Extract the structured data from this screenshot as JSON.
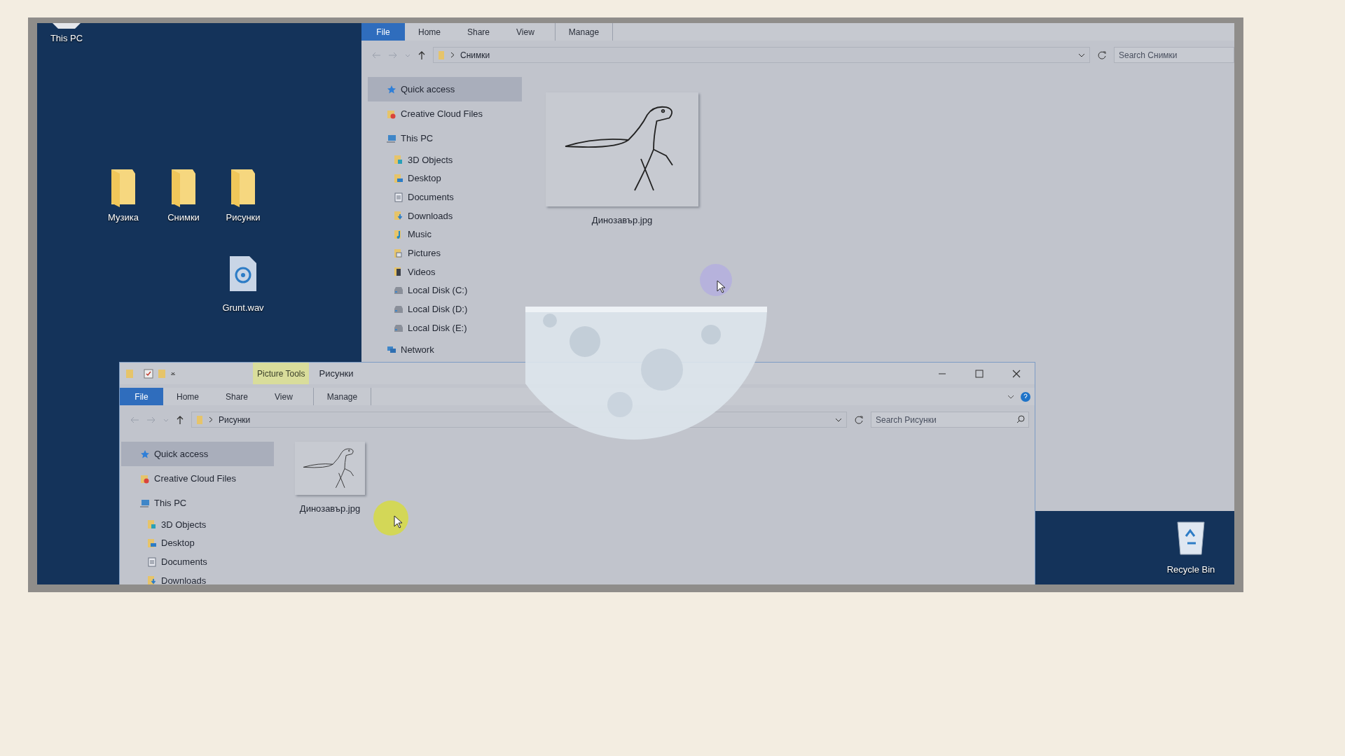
{
  "desktop": {
    "icons": [
      {
        "label": "This PC",
        "kind": "pc"
      },
      {
        "label": "Музика",
        "kind": "folder"
      },
      {
        "label": "Снимки",
        "kind": "folder"
      },
      {
        "label": "Рисунки",
        "kind": "folder"
      },
      {
        "label": "Grunt.wav",
        "kind": "audio"
      },
      {
        "label": "Recycle Bin",
        "kind": "recycle"
      }
    ]
  },
  "back_window": {
    "tabs": [
      {
        "label": "File",
        "selected": true
      },
      {
        "label": "Home",
        "selected": false
      },
      {
        "label": "Share",
        "selected": false
      },
      {
        "label": "View",
        "selected": false
      },
      {
        "label": "Manage",
        "selected": false
      }
    ],
    "address": "Снимки",
    "search": {
      "placeholder": "Search Снимки"
    },
    "nav": [
      {
        "label": "Quick access",
        "kind": "star",
        "selected": true
      },
      {
        "label": "Creative Cloud Files",
        "kind": "cloud",
        "selected": false
      },
      {
        "label": "This PC",
        "kind": "pc",
        "selected": false,
        "children": [
          {
            "label": "3D Objects",
            "kind": "cube",
            "selected": false
          },
          {
            "label": "Desktop",
            "kind": "desktop",
            "selected": false
          },
          {
            "label": "Documents",
            "kind": "document",
            "selected": false
          },
          {
            "label": "Downloads",
            "kind": "download",
            "selected": false
          },
          {
            "label": "Music",
            "kind": "music",
            "selected": false
          },
          {
            "label": "Pictures",
            "kind": "pictures",
            "selected": false
          },
          {
            "label": "Videos",
            "kind": "video",
            "selected": false
          },
          {
            "label": "Local Disk (C:)",
            "kind": "disk",
            "selected": false
          },
          {
            "label": "Local Disk (D:)",
            "kind": "disk",
            "selected": false
          },
          {
            "label": "Local Disk (E:)",
            "kind": "disk",
            "selected": false
          }
        ]
      },
      {
        "label": "Network",
        "kind": "network",
        "selected": false
      }
    ],
    "files": [
      {
        "name": "Динозавър.jpg"
      }
    ]
  },
  "front_window": {
    "title": "Рисунки",
    "context_tab": "Picture Tools",
    "tabs": [
      {
        "label": "File",
        "selected": true
      },
      {
        "label": "Home",
        "selected": false
      },
      {
        "label": "Share",
        "selected": false
      },
      {
        "label": "View",
        "selected": false
      },
      {
        "label": "Manage",
        "selected": false
      }
    ],
    "address": "Рисунки",
    "search": {
      "placeholder": "Search Рисунки"
    },
    "nav": [
      {
        "label": "Quick access",
        "kind": "star",
        "selected": true
      },
      {
        "label": "Creative Cloud Files",
        "kind": "cloud",
        "selected": false
      },
      {
        "label": "This PC",
        "kind": "pc",
        "selected": false,
        "children": [
          {
            "label": "3D Objects",
            "kind": "cube",
            "selected": false
          },
          {
            "label": "Desktop",
            "kind": "desktop",
            "selected": false
          },
          {
            "label": "Documents",
            "kind": "document",
            "selected": false
          },
          {
            "label": "Downloads",
            "kind": "download",
            "selected": false
          }
        ]
      }
    ],
    "files": [
      {
        "name": "Динозавър.jpg"
      }
    ]
  }
}
